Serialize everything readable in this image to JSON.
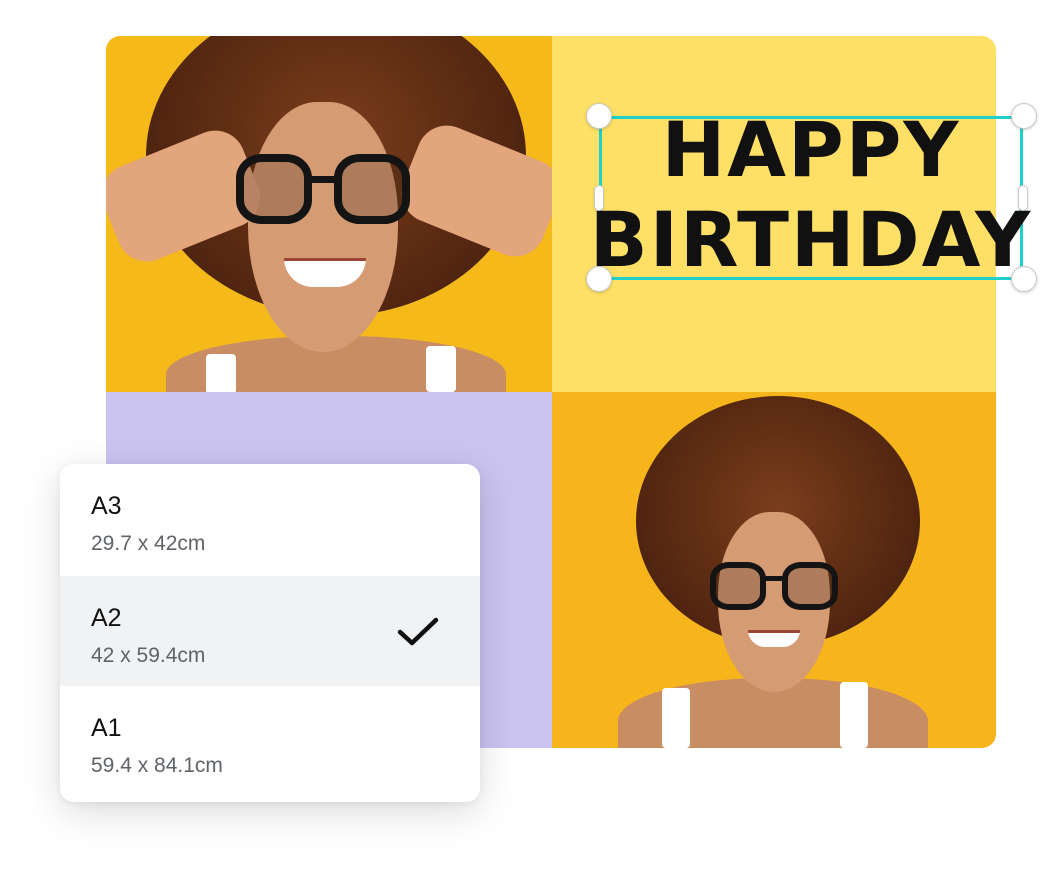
{
  "canvas": {
    "headline": {
      "line1": "HAPPY",
      "line2": "BIRTHDAY"
    },
    "colors": {
      "photo_bg_1": "#f6b91a",
      "text_panel": "#ffe066",
      "lavender_panel": "#cbc3f0",
      "photo_bg_2": "#f7b51c",
      "selection": "#1fd1c8"
    }
  },
  "size_menu": {
    "options": [
      {
        "name": "A3",
        "dimensions": "29.7 x 42cm",
        "selected": false
      },
      {
        "name": "A2",
        "dimensions": "42 x 59.4cm",
        "selected": true
      },
      {
        "name": "A1",
        "dimensions": "59.4 x 84.1cm",
        "selected": false
      }
    ],
    "selected_icon": "checkmark-icon"
  }
}
